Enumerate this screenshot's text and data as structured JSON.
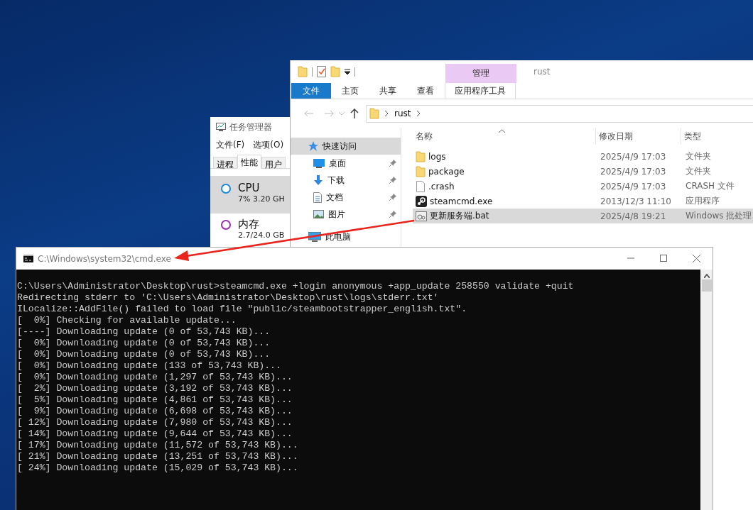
{
  "task_manager": {
    "title": "任务管理器",
    "menu": [
      "文件(F)",
      "选项(O)"
    ],
    "tabs": [
      {
        "label": "进程",
        "selected": false
      },
      {
        "label": "性能",
        "selected": true
      },
      {
        "label": "用户",
        "selected": false
      }
    ],
    "resources": [
      {
        "name": "CPU",
        "detail": "7% 3.20 GH",
        "selected": true,
        "color": "#1c8ad6"
      },
      {
        "name": "内存",
        "detail": "2.7/24.0 GB",
        "selected": false,
        "color": "#9a2fb0"
      }
    ]
  },
  "explorer": {
    "title": "rust",
    "context_tab": "管理",
    "ribbon_tabs": [
      {
        "label": "文件",
        "kind": "file"
      },
      {
        "label": "主页",
        "kind": "plain"
      },
      {
        "label": "共享",
        "kind": "plain"
      },
      {
        "label": "查看",
        "kind": "plain"
      },
      {
        "label": "应用程序工具",
        "kind": "context"
      }
    ],
    "address": [
      "rust"
    ],
    "nav_items": [
      {
        "label": "快速访问",
        "kind": "star",
        "selected": true,
        "pinned": false
      },
      {
        "label": "桌面",
        "kind": "desktop",
        "selected": false,
        "pinned": true
      },
      {
        "label": "下载",
        "kind": "download",
        "selected": false,
        "pinned": true
      },
      {
        "label": "文档",
        "kind": "document",
        "selected": false,
        "pinned": true
      },
      {
        "label": "图片",
        "kind": "pictures",
        "selected": false,
        "pinned": true
      },
      {
        "label": "此电脑",
        "kind": "computer",
        "selected": false,
        "pinned": false
      }
    ],
    "columns": [
      "名称",
      "修改日期",
      "类型"
    ],
    "files": [
      {
        "name": "logs",
        "date": "2025/4/9 17:03",
        "type": "文件夹",
        "kind": "folder",
        "selected": false
      },
      {
        "name": "package",
        "date": "2025/4/9 17:03",
        "type": "文件夹",
        "kind": "folder",
        "selected": false
      },
      {
        "name": ".crash",
        "date": "2025/4/9 17:03",
        "type": "CRASH 文件",
        "kind": "file",
        "selected": false
      },
      {
        "name": "steamcmd.exe",
        "date": "2013/12/3 11:10",
        "type": "应用程序",
        "kind": "app",
        "selected": false
      },
      {
        "name": "更新服务端.bat",
        "date": "2025/4/8 19:21",
        "type": "Windows 批处理",
        "kind": "script",
        "selected": true
      }
    ]
  },
  "console": {
    "title": "C:\\Windows\\system32\\cmd.exe",
    "lines": [
      "C:\\Users\\Administrator\\Desktop\\rust>steamcmd.exe +login anonymous +app_update 258550 validate +quit",
      "Redirecting stderr to 'C:\\Users\\Administrator\\Desktop\\rust\\logs\\stderr.txt'",
      "ILocalize::AddFile() failed to load file \"public/steambootstrapper_english.txt\".",
      "[  0%] Checking for available update...",
      "[----] Downloading update (0 of 53,743 KB)...",
      "[  0%] Downloading update (0 of 53,743 KB)...",
      "[  0%] Downloading update (0 of 53,743 KB)...",
      "[  0%] Downloading update (133 of 53,743 KB)...",
      "[  0%] Downloading update (1,297 of 53,743 KB)...",
      "[  2%] Downloading update (3,192 of 53,743 KB)...",
      "[  5%] Downloading update (4,861 of 53,743 KB)...",
      "[  9%] Downloading update (6,698 of 53,743 KB)...",
      "[ 12%] Downloading update (7,980 of 53,743 KB)...",
      "[ 14%] Downloading update (9,644 of 53,743 KB)...",
      "[ 17%] Downloading update (11,572 of 53,743 KB)...",
      "[ 21%] Downloading update (13,251 of 53,743 KB)...",
      "[ 24%] Downloading update (15,029 of 53,743 KB)..."
    ]
  }
}
